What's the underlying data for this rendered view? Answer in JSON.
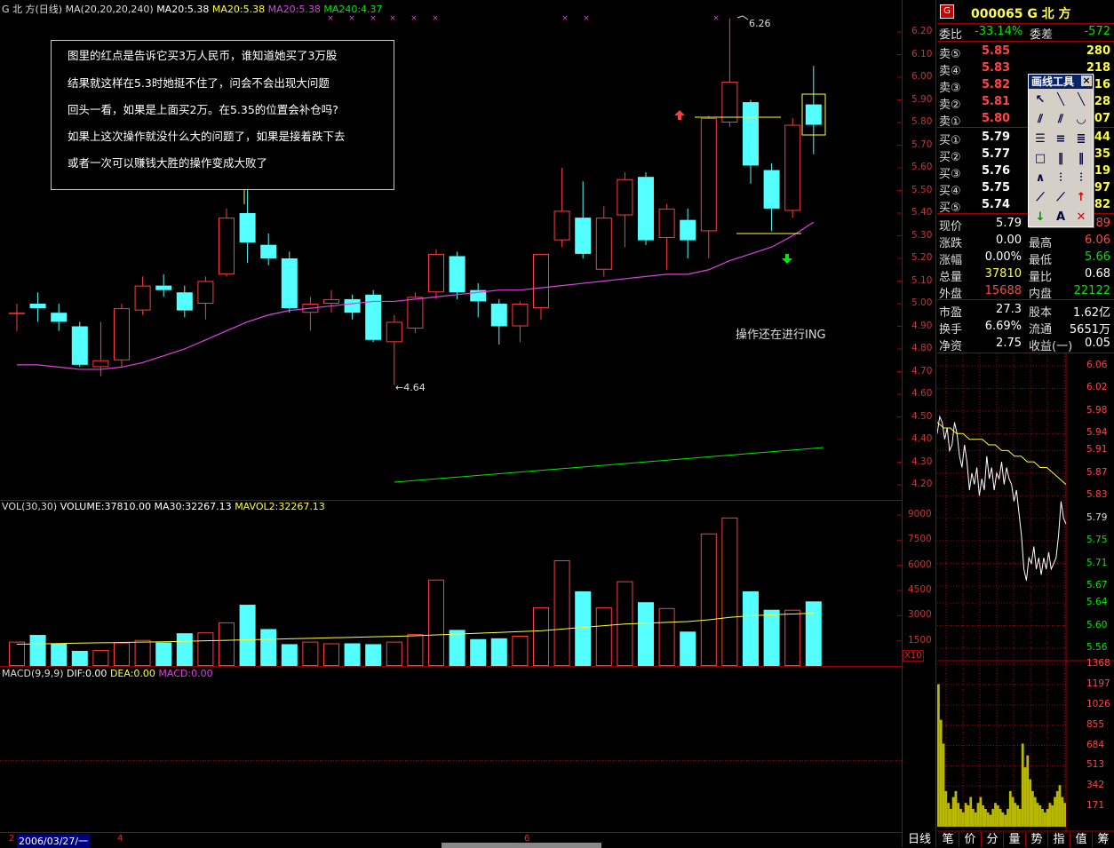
{
  "chart_header": {
    "name": "G 北  方(日线)",
    "ma_params": "MA(20,20,20,240)",
    "ma1": "MA20:5.38",
    "ma2": "MA20:5.38",
    "ma3": "MA20:5.38",
    "ma4": "MA240:4.37"
  },
  "price_axis": [
    "6.20",
    "6.10",
    "6.00",
    "5.90",
    "5.80",
    "5.70",
    "5.60",
    "5.50",
    "5.40",
    "5.30",
    "5.20",
    "5.10",
    "5.00",
    "4.90",
    "4.80",
    "4.70",
    "4.60",
    "4.50",
    "4.40",
    "4.30",
    "4.20"
  ],
  "note_lines": [
    "图里的红点是告诉它买3万人民币，谁知道她买了3万股",
    "结果就这样在5.3时她挺不住了，问会不会出现大问题",
    "回头一看，如果是上面买2万。在5.35的位置会补仓吗?",
    "如果上这次操作就没什么大的问题了，如果是接着跌下去",
    "或者一次可以赚钱大胜的操作变成大败了"
  ],
  "high_marker": "6.26",
  "low_marker": "4.64",
  "status_text": "操作还在进行ING",
  "volume_header": {
    "label": "VOL(30,30)",
    "volume": "VOLUME:37810.00",
    "ma30": "MA30:32267.13",
    "mavol2": "MAVOL2:32267.13"
  },
  "volume_axis": [
    "9000",
    "7500",
    "6000",
    "4500",
    "3000",
    "1500"
  ],
  "volume_scale": "X10",
  "macd_header": {
    "label": "MACD(9,9,9)",
    "dif": "DIF:0.00",
    "dea": "DEA:0.00",
    "macd": "MACD:0.00"
  },
  "date_label": "2006/03/27/一",
  "timeline_marks": [
    "2",
    "4",
    "6"
  ],
  "quote": {
    "code_name": "000065 G 北   方",
    "webi_label": "委比",
    "webi_value": "-33.14%",
    "wecha_label": "委差",
    "wecha_value": "-572",
    "sell": [
      {
        "label": "卖⑤",
        "price": "5.85",
        "vol": "280"
      },
      {
        "label": "卖④",
        "price": "5.83",
        "vol": "218"
      },
      {
        "label": "卖③",
        "price": "5.82",
        "vol": "16"
      },
      {
        "label": "卖②",
        "price": "5.81",
        "vol": "28"
      },
      {
        "label": "卖①",
        "price": "5.80",
        "vol": "07"
      }
    ],
    "buy": [
      {
        "label": "买①",
        "price": "5.79",
        "vol": "44"
      },
      {
        "label": "买②",
        "price": "5.77",
        "vol": "35"
      },
      {
        "label": "买③",
        "price": "5.76",
        "vol": "19"
      },
      {
        "label": "买④",
        "price": "5.75",
        "vol": "97"
      },
      {
        "label": "买⑤",
        "price": "5.74",
        "vol": "82"
      }
    ],
    "stats": [
      {
        "l1": "现价",
        "v1": "5.79",
        "l2": "",
        "v2": "89"
      },
      {
        "l1": "涨跌",
        "v1": "0.00",
        "l2": "最高",
        "v2": "6.06"
      },
      {
        "l1": "涨幅",
        "v1": "0.00%",
        "l2": "最低",
        "v2": "5.66"
      },
      {
        "l1": "总量",
        "v1": "37810",
        "l2": "量比",
        "v2": "0.68"
      },
      {
        "l1": "外盘",
        "v1": "15688",
        "l2": "内盘",
        "v2": "22122"
      }
    ],
    "fund": [
      {
        "l1": "市盈",
        "v1": "27.3",
        "l2": "股本",
        "v2": "1.62亿"
      },
      {
        "l1": "换手",
        "v1": "6.69%",
        "l2": "流通",
        "v2": "5651万"
      },
      {
        "l1": "净资",
        "v1": "2.75",
        "l2": "收益(一)",
        "v2": "0.05"
      }
    ]
  },
  "intraday_price_axis": [
    "6.06",
    "6.02",
    "5.98",
    "5.94",
    "5.91",
    "5.87",
    "5.83",
    "5.79",
    "5.75",
    "5.71",
    "5.67",
    "5.64",
    "5.60",
    "5.56"
  ],
  "intraday_volume_axis": [
    "1368",
    "1197",
    "1026",
    "855",
    "684",
    "513",
    "342",
    "171"
  ],
  "toolbox": {
    "title": "画线工具",
    "close": "×",
    "text_tool": "A"
  },
  "tabs_left": [
    "日线"
  ],
  "tabs_right": [
    "笔",
    "价",
    "分",
    "量",
    "势",
    "指",
    "值",
    "筹"
  ],
  "colors": {
    "up": "#ff3c3c",
    "down": "#54ffff",
    "ma": "#e040e0",
    "grid": "#a00000"
  },
  "chart_data": {
    "type": "candlestick",
    "price_range": [
      4.15,
      6.25
    ],
    "candles": [
      {
        "o": 4.96,
        "c": 4.96,
        "h": 5.0,
        "l": 4.88
      },
      {
        "o": 5.0,
        "c": 4.98,
        "h": 5.05,
        "l": 4.92
      },
      {
        "o": 4.96,
        "c": 4.92,
        "h": 5.0,
        "l": 4.88
      },
      {
        "o": 4.9,
        "c": 4.73,
        "h": 4.92,
        "l": 4.72
      },
      {
        "o": 4.72,
        "c": 4.75,
        "h": 4.92,
        "l": 4.68
      },
      {
        "o": 4.75,
        "c": 4.98,
        "h": 5.0,
        "l": 4.72
      },
      {
        "o": 4.97,
        "c": 5.08,
        "h": 5.12,
        "l": 4.95
      },
      {
        "o": 5.08,
        "c": 5.06,
        "h": 5.13,
        "l": 5.03
      },
      {
        "o": 5.05,
        "c": 4.97,
        "h": 5.08,
        "l": 4.94
      },
      {
        "o": 5.0,
        "c": 5.1,
        "h": 5.12,
        "l": 4.93
      },
      {
        "o": 5.13,
        "c": 5.38,
        "h": 5.42,
        "l": 5.12
      },
      {
        "o": 5.4,
        "c": 5.27,
        "h": 5.55,
        "l": 5.18
      },
      {
        "o": 5.26,
        "c": 5.2,
        "h": 5.31,
        "l": 5.17
      },
      {
        "o": 5.2,
        "c": 4.98,
        "h": 5.23,
        "l": 4.96
      },
      {
        "o": 4.96,
        "c": 5.0,
        "h": 5.03,
        "l": 4.88
      },
      {
        "o": 5.0,
        "c": 5.02,
        "h": 5.06,
        "l": 4.96
      },
      {
        "o": 5.02,
        "c": 4.96,
        "h": 5.04,
        "l": 4.93
      },
      {
        "o": 5.04,
        "c": 4.84,
        "h": 5.06,
        "l": 4.83
      },
      {
        "o": 4.83,
        "c": 4.92,
        "h": 4.95,
        "l": 4.64
      },
      {
        "o": 4.89,
        "c": 5.03,
        "h": 5.05,
        "l": 4.87
      },
      {
        "o": 5.05,
        "c": 5.22,
        "h": 5.24,
        "l": 5.02
      },
      {
        "o": 5.21,
        "c": 5.05,
        "h": 5.23,
        "l": 5.02
      },
      {
        "o": 5.06,
        "c": 5.01,
        "h": 5.09,
        "l": 4.94
      },
      {
        "o": 5.0,
        "c": 4.9,
        "h": 5.02,
        "l": 4.82
      },
      {
        "o": 4.9,
        "c": 5.0,
        "h": 5.01,
        "l": 4.83
      },
      {
        "o": 4.98,
        "c": 5.22,
        "h": 5.22,
        "l": 4.93
      },
      {
        "o": 5.28,
        "c": 5.41,
        "h": 5.6,
        "l": 5.25
      },
      {
        "o": 5.38,
        "c": 5.22,
        "h": 5.54,
        "l": 5.2
      },
      {
        "o": 5.15,
        "c": 5.38,
        "h": 5.43,
        "l": 5.12
      },
      {
        "o": 5.39,
        "c": 5.55,
        "h": 5.58,
        "l": 5.25
      },
      {
        "o": 5.56,
        "c": 5.28,
        "h": 5.58,
        "l": 5.26
      },
      {
        "o": 5.29,
        "c": 5.42,
        "h": 5.44,
        "l": 5.15
      },
      {
        "o": 5.37,
        "c": 5.28,
        "h": 5.42,
        "l": 5.2
      },
      {
        "o": 5.32,
        "c": 5.82,
        "h": 5.83,
        "l": 5.2
      },
      {
        "o": 5.8,
        "c": 5.98,
        "h": 6.26,
        "l": 5.78
      },
      {
        "o": 5.89,
        "c": 5.61,
        "h": 5.9,
        "l": 5.53
      },
      {
        "o": 5.59,
        "c": 5.42,
        "h": 5.62,
        "l": 5.32
      },
      {
        "o": 5.41,
        "c": 5.79,
        "h": 5.82,
        "l": 5.38
      },
      {
        "o": 5.88,
        "c": 5.79,
        "h": 6.05,
        "l": 5.66
      }
    ],
    "ma_values": [
      4.73,
      4.73,
      4.72,
      4.71,
      4.71,
      4.72,
      4.74,
      4.77,
      4.8,
      4.84,
      4.88,
      4.92,
      4.95,
      4.97,
      4.98,
      4.99,
      5.0,
      5.01,
      5.01,
      5.02,
      5.03,
      5.04,
      5.05,
      5.06,
      5.06,
      5.07,
      5.08,
      5.09,
      5.1,
      5.11,
      5.12,
      5.13,
      5.13,
      5.15,
      5.19,
      5.22,
      5.25,
      5.3,
      5.36
    ],
    "volumes": [
      1450,
      1850,
      1350,
      900,
      950,
      1400,
      1550,
      1400,
      1950,
      2000,
      2600,
      3650,
      2200,
      1300,
      1450,
      1350,
      1350,
      1300,
      1450,
      1900,
      5150,
      2150,
      1600,
      1650,
      1800,
      3500,
      6300,
      4450,
      3500,
      5050,
      3800,
      3450,
      2050,
      7900,
      8850,
      4450,
      3350,
      3350,
      3850
    ],
    "volume_ma": [
      1300,
      1320,
      1340,
      1360,
      1380,
      1400,
      1420,
      1440,
      1470,
      1500,
      1530,
      1560,
      1590,
      1620,
      1650,
      1680,
      1710,
      1740,
      1770,
      1800,
      1850,
      1900,
      1950,
      2000,
      2050,
      2100,
      2200,
      2300,
      2400,
      2500,
      2550,
      2600,
      2650,
      2750,
      2900,
      3000,
      3050,
      3100,
      3150
    ],
    "volume_range": [
      0,
      9800
    ]
  }
}
